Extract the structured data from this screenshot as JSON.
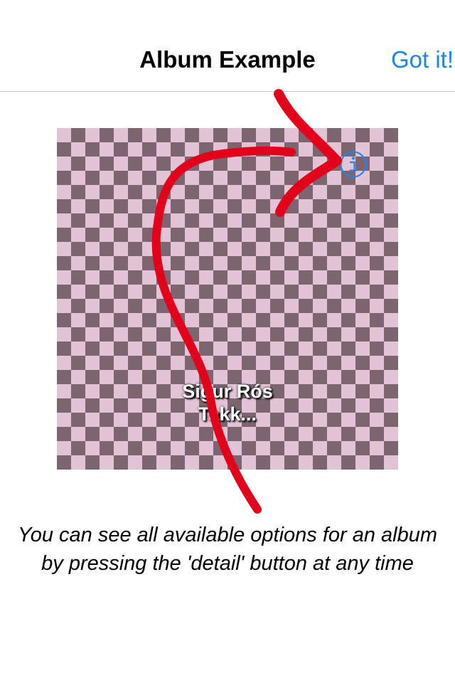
{
  "nav": {
    "title": "Album Example",
    "action_label": "Got it!",
    "accent_color": "#1a86f0"
  },
  "album": {
    "line1": "Sigur Rós",
    "line2": "Takk...",
    "detail_icon": "info-icon",
    "placeholder_colors": [
      "#7c6570",
      "#e3c3d6"
    ]
  },
  "annotation": {
    "arrow_icon": "hand-drawn-arrow-icon",
    "arrow_color": "#e3001b"
  },
  "hint": {
    "text": "You can see all available options for an album by pressing the 'detail' button at any time"
  }
}
